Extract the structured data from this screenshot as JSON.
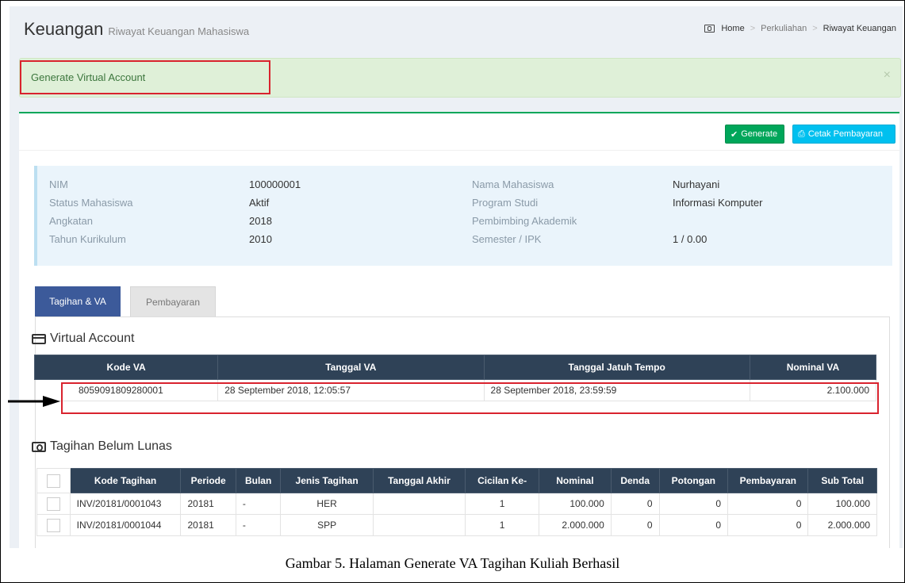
{
  "header": {
    "title": "Keuangan",
    "subtitle": "Riwayat Keuangan Mahasiswa",
    "breadcrumb": [
      "Home",
      "Perkuliahan",
      "Riwayat Keuangan"
    ]
  },
  "alert": {
    "message": "Generate Virtual Account",
    "close": "×"
  },
  "toolbar": {
    "generate_label": "Generate",
    "print_label": "Cetak Pembayaran"
  },
  "student": {
    "nim_label": "NIM",
    "nim": "100000001",
    "status_label": "Status Mahasiswa",
    "status": "Aktif",
    "angkatan_label": "Angkatan",
    "angkatan": "2018",
    "kurikulum_label": "Tahun Kurikulum",
    "kurikulum": "2010",
    "nama_label": "Nama Mahasiswa",
    "nama": "Nurhayani",
    "prodi_label": "Program Studi",
    "prodi": "Informasi Komputer",
    "pa_label": "Pembimbing Akademik",
    "pa": "",
    "semester_label": "Semester / IPK",
    "semester": "1 / 0.00"
  },
  "tabs": [
    {
      "label": "Tagihan & VA"
    },
    {
      "label": "Pembayaran"
    }
  ],
  "va_section": {
    "title": "Virtual Account",
    "columns": [
      "Kode VA",
      "Tanggal VA",
      "Tanggal Jatuh Tempo",
      "Nominal VA"
    ],
    "rows": [
      {
        "kode": "8059091809280001",
        "tanggal": "28 September 2018, 12:05:57",
        "jatuh_tempo": "28 September 2018, 23:59:59",
        "nominal": "2.100.000"
      }
    ]
  },
  "tagihan_section": {
    "title": "Tagihan Belum Lunas",
    "columns": [
      "Kode Tagihan",
      "Periode",
      "Bulan",
      "Jenis Tagihan",
      "Tanggal Akhir",
      "Cicilan Ke-",
      "Nominal",
      "Denda",
      "Potongan",
      "Pembayaran",
      "Sub Total"
    ],
    "rows": [
      {
        "kode": "INV/20181/0001043",
        "periode": "20181",
        "bulan": "-",
        "jenis": "HER",
        "tanggal_akhir": "",
        "cicilan": "1",
        "nominal": "100.000",
        "denda": "0",
        "potongan": "0",
        "pembayaran": "0",
        "subtotal": "100.000"
      },
      {
        "kode": "INV/20181/0001044",
        "periode": "20181",
        "bulan": "-",
        "jenis": "SPP",
        "tanggal_akhir": "",
        "cicilan": "1",
        "nominal": "2.000.000",
        "denda": "0",
        "potongan": "0",
        "pembayaran": "0",
        "subtotal": "2.000.000"
      }
    ]
  },
  "caption": "Gambar 5. Halaman Generate VA Tagihan Kuliah Berhasil",
  "colors": {
    "accent_blue": "#3c5a9a",
    "success": "#00a65a",
    "info": "#00c0ef",
    "highlight": "#d9232e",
    "table_header": "#2f4257"
  }
}
